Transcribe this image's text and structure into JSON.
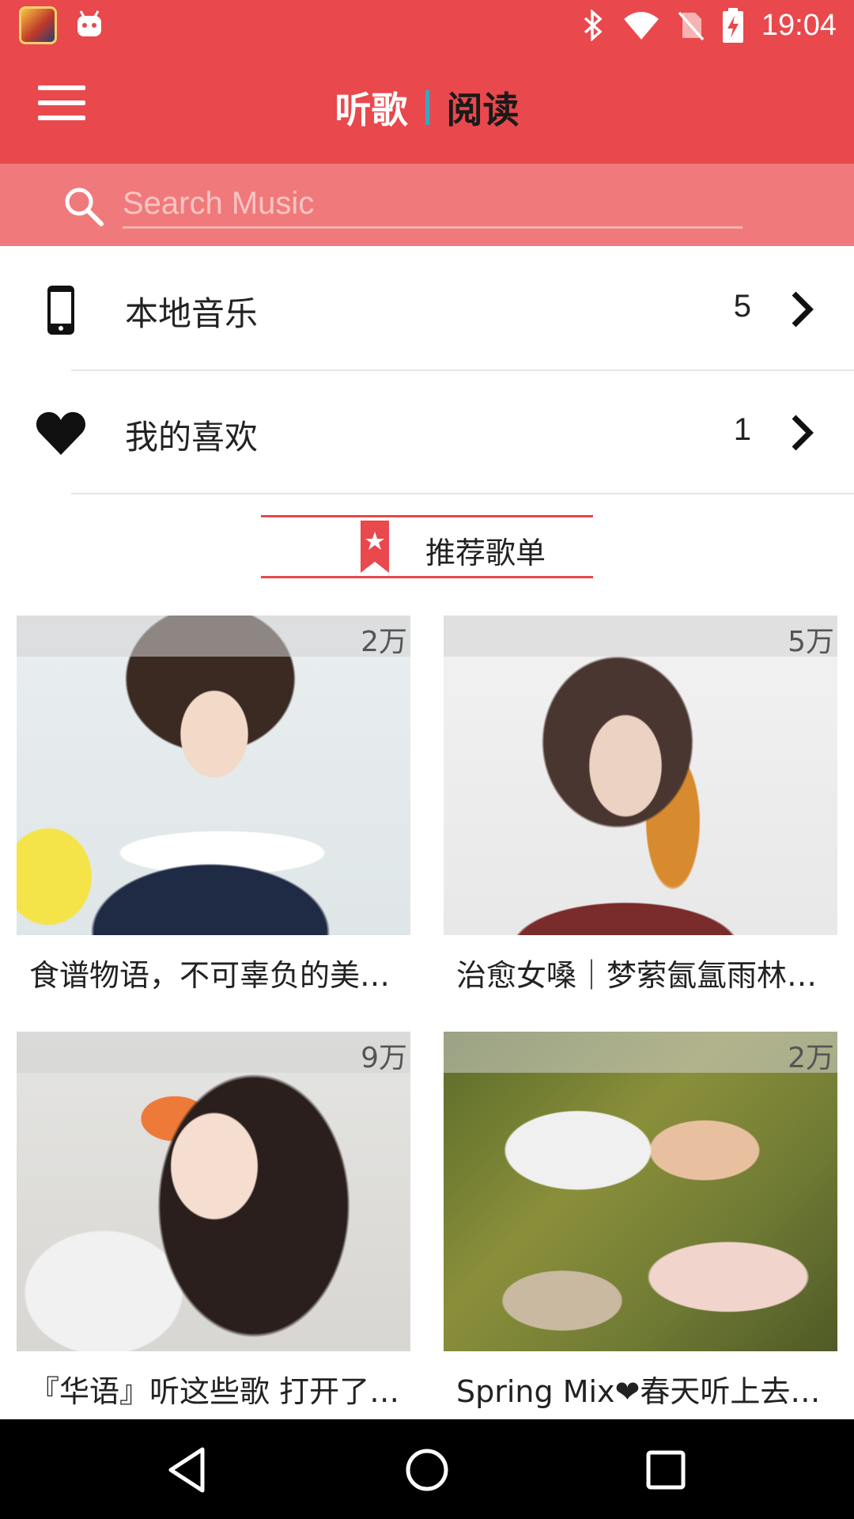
{
  "status_bar": {
    "time": "19:04",
    "icons": [
      "game-app-icon",
      "android-icon",
      "bluetooth-icon",
      "wifi-icon",
      "no-sim-icon",
      "battery-charging-icon"
    ]
  },
  "toolbar": {
    "tabs": [
      {
        "label": "听歌",
        "active": true
      },
      {
        "label": "阅读",
        "active": false
      }
    ],
    "menu_icon": "hamburger-menu-icon"
  },
  "search": {
    "placeholder": "Search Music",
    "value": ""
  },
  "rows": [
    {
      "label": "本地音乐",
      "count": "5",
      "icon": "phone-icon"
    },
    {
      "label": "我的喜欢",
      "count": "1",
      "icon": "heart-icon"
    }
  ],
  "section": {
    "title": "推荐歌单",
    "icon": "bookmark-star-icon"
  },
  "playlists": [
    {
      "title": "食谱物语，不可辜负的美食…",
      "play_count": "2万"
    },
    {
      "title": "治愈女嗓｜梦萦氤氲雨林，…",
      "play_count": "5万"
    },
    {
      "title": "『华语』听这些歌 打开了谁…",
      "play_count": "9万"
    },
    {
      "title": "Spring Mix❤春天听上去是…",
      "play_count": "2万"
    }
  ],
  "nav": {
    "buttons": [
      "back-icon",
      "home-icon",
      "recents-icon"
    ]
  },
  "colors": {
    "primary": "#e9484c",
    "search_bg": "#f07a7b",
    "tab_divider": "#3aa6c4"
  }
}
